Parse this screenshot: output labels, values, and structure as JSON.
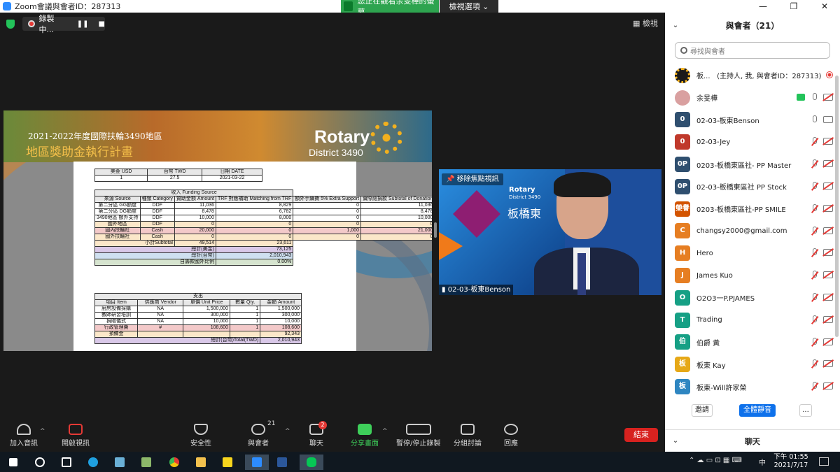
{
  "window": {
    "title": "Zoom會議與會者ID：287313",
    "share_notice": "您正在觀看余旻樺的螢幕",
    "view_options": "檢視選項 ⌄",
    "minimize": "—",
    "maximize": "❐",
    "close": "✕"
  },
  "meeting": {
    "recording_label": "錄製中...",
    "pause": "❚❚",
    "stop": "■",
    "gallery_view": "▦ 檢視"
  },
  "slide": {
    "line1": "2021-2022年度國際扶輪3490地區",
    "line2": "地區獎助金執行計畫",
    "brand": "Rotary",
    "district": "District 3490",
    "top_table": {
      "rows": [
        [
          "美金\nUSD",
          "台幣\nTWD",
          "日期\nDATE"
        ],
        [
          "1",
          "27.5",
          "2021-03-22"
        ]
      ]
    },
    "funding": {
      "title": "收入 Funding Source",
      "headers": [
        "來源\nSource",
        "種類\nCategory",
        "贊助金額\nAmount",
        "TRF\n對應補助\nMatching\nfrom TRF",
        "額外手續費\n5%\nExtra\nSupport",
        "實際總捐款\nSubtotal of\nDonation"
      ],
      "rows": [
        [
          "第二分區\nGG額度",
          "DDF",
          "11,036",
          "8,829",
          "0",
          "11,036"
        ],
        [
          "第二分區\nDG額度",
          "DDF",
          "8,478",
          "6,782",
          "0",
          "8,478"
        ],
        [
          "3490地區\n額外支持",
          "DDF",
          "10,000",
          "8,000",
          "0",
          "10,000"
        ],
        [
          "國外地區",
          "DDF",
          "0",
          "0",
          "0",
          "0"
        ],
        [
          "國內扶輪社",
          "Cash",
          "20,000",
          "0",
          "1,000",
          "21,000"
        ],
        [
          "國外扶輪社",
          "Cash",
          "0",
          "0",
          "0",
          "0"
        ]
      ],
      "subtotal_label": "小計Subtotal",
      "subtotal_values": [
        "49,514",
        "23,611"
      ],
      "total_usd_label": "總計(美金)",
      "total_usd": "73,125",
      "total_twd_label": "總計(台幣)",
      "total_twd": "2,010,943",
      "foreign_ratio_label": "自籌款國外比例",
      "foreign_ratio": "0.00%"
    },
    "expense": {
      "title": "支出",
      "headers": [
        "項目\nItem",
        "供應商\nVendor",
        "單價\nUnit Price",
        "數量\nQty.",
        "金額\nAmount"
      ],
      "rows": [
        [
          "廚房設備採購",
          "NA",
          "1,500,000",
          "1",
          "1,500,000"
        ],
        [
          "教師研習培訓",
          "NA",
          "300,000",
          "1",
          "300,000"
        ],
        [
          "捐贈儀式",
          "NA",
          "10,000",
          "1",
          "10,000"
        ],
        [
          "行政管理費",
          "#",
          "108,600",
          "1",
          "108,600"
        ],
        [
          "預備金",
          "",
          "",
          "",
          "92,343"
        ]
      ],
      "total_label": "總計(台幣)Total(TWD)",
      "total": "2,010,943"
    }
  },
  "video": {
    "pin_label": "移除焦點視訊",
    "brand": "Rotary",
    "district": "District 3490",
    "name_text": "板橋東",
    "participant_label": "02-03-板東Benson"
  },
  "toolbar": {
    "audio": "加入音訊",
    "video": "開啟視訊",
    "security": "安全性",
    "participants": "與會者",
    "participants_count": "21",
    "chat": "聊天",
    "chat_badge": "2",
    "share": "分享畫面",
    "record": "暫停/停止錄製",
    "breakout": "分組討論",
    "reactions": "回應",
    "end": "結束"
  },
  "panel": {
    "title": "與會者（21）",
    "search_placeholder": "尋找與會者",
    "participants": [
      {
        "avatar": "",
        "color": "#c79a2a",
        "name": "板...   (主持人, 我, 與會者ID：287313)",
        "icons": "rec"
      },
      {
        "avatar": "",
        "color": "#d9a0a0",
        "name": "余旻樺",
        "icons": "share-mic-camoff"
      },
      {
        "avatar": "0",
        "color": "#2f4f6f",
        "name": "02-03-板東Benson",
        "icons": "mic-cam"
      },
      {
        "avatar": "0",
        "color": "#c0392b",
        "name": "02-03-Jey",
        "icons": "off"
      },
      {
        "avatar": "0P",
        "color": "#2f4f6f",
        "name": "0203-板橋東區社- PP Master",
        "icons": "off"
      },
      {
        "avatar": "0P",
        "color": "#2f4f6f",
        "name": "02-03-板橋東區社 PP Stock",
        "icons": "off"
      },
      {
        "avatar": "榮譽",
        "color": "#d35400",
        "name": "0203-板橋東區社-PP SMILE",
        "icons": "off"
      },
      {
        "avatar": "C",
        "color": "#e67e22",
        "name": "changsy2000@gmail.com",
        "icons": "off"
      },
      {
        "avatar": "H",
        "color": "#e67e22",
        "name": "Hero",
        "icons": "off"
      },
      {
        "avatar": "J",
        "color": "#e67e22",
        "name": "James Kuo",
        "icons": "off"
      },
      {
        "avatar": "O",
        "color": "#16a085",
        "name": "O2O3一P.PJAMES",
        "icons": "off"
      },
      {
        "avatar": "T",
        "color": "#16a085",
        "name": "Trading",
        "icons": "off"
      },
      {
        "avatar": "伯",
        "color": "#16a085",
        "name": "伯爵 黃",
        "icons": "off"
      },
      {
        "avatar": "板",
        "color": "#e6a817",
        "name": "板東 Kay",
        "icons": "off"
      },
      {
        "avatar": "板",
        "color": "#2e86c1",
        "name": "板東-Will許家榮",
        "icons": "off"
      }
    ],
    "invite": "邀請",
    "mute_all": "全體靜音",
    "more": "...",
    "chat": "聊天"
  },
  "taskbar": {
    "time": "下午 01:55",
    "date": "2021/7/17",
    "tray_text": "⌃  ☁  ▭  ⊡  ▦  ⌨",
    "ime": "中"
  }
}
